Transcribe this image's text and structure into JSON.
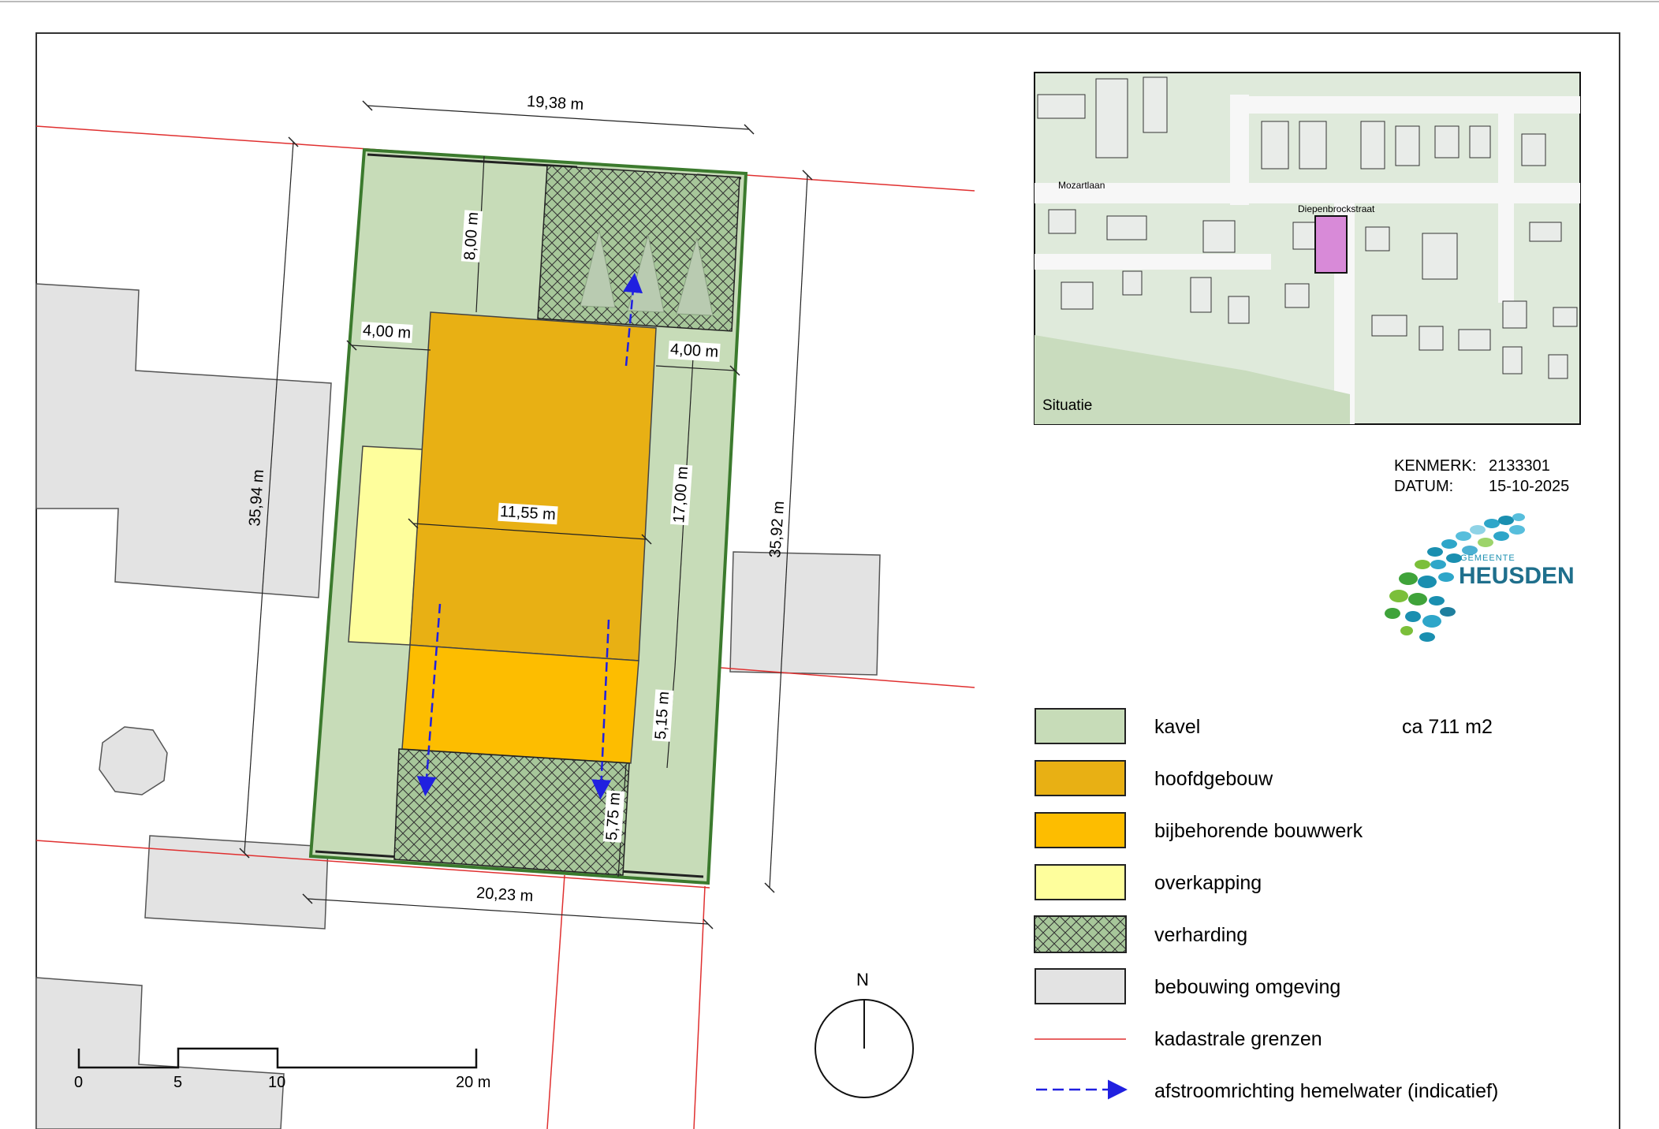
{
  "dimensions": {
    "top_width": "19,38 m",
    "bottom_width": "20,23 m",
    "left_depth": "35,94 m",
    "right_depth": "35,92 m",
    "front_setback": "8,00 m",
    "left_setback": "4,00 m",
    "right_setback": "4,00 m",
    "building_width": "11,55 m",
    "building_depth": "17,00 m",
    "annex_depth": "5,15 m",
    "rear_paving": "5,75 m"
  },
  "inset": {
    "caption": "Situatie",
    "street_1": "Mozartlaan",
    "street_2": "Diepenbrockstraat"
  },
  "meta": {
    "kenmerk_label": "KENMERK:",
    "kenmerk_value": "2133301",
    "datum_label": "DATUM:",
    "datum_value": "15-10-2025"
  },
  "logo": {
    "small_text": "GEMEENTE",
    "big_text": "HEUSDEN"
  },
  "legend": [
    {
      "label": "kavel",
      "value": "ca 711 m2",
      "fill": "#c7dcb8"
    },
    {
      "label": "hoofdgebouw",
      "value": "",
      "fill": "#e8b014"
    },
    {
      "label": "bijbehorende bouwwerk",
      "value": "",
      "fill": "#fdbd00"
    },
    {
      "label": "overkapping",
      "value": "",
      "fill": "#fefe9c"
    },
    {
      "label": "verharding",
      "value": "",
      "fill": "hatch"
    },
    {
      "label": "bebouwing omgeving",
      "value": "",
      "fill": "#e3e3e3"
    },
    {
      "label": "kadastrale grenzen",
      "value": "",
      "fill": "line-red"
    },
    {
      "label": "afstroomrichting hemelwater (indicatief)",
      "value": "",
      "fill": "arrow-blue"
    }
  ],
  "north": "N",
  "scale": {
    "ticks": [
      "0",
      "5",
      "10",
      "20 m"
    ]
  },
  "colors": {
    "kavel": "#c7dcb8",
    "kavel_border": "#4a8a3a",
    "hoofdgebouw": "#e8b014",
    "bijbehorend": "#fdbd00",
    "overkapping": "#fefe9c",
    "omgeving": "#e3e3e3",
    "cadastral": "#e03030",
    "arrow": "#2020e0"
  }
}
